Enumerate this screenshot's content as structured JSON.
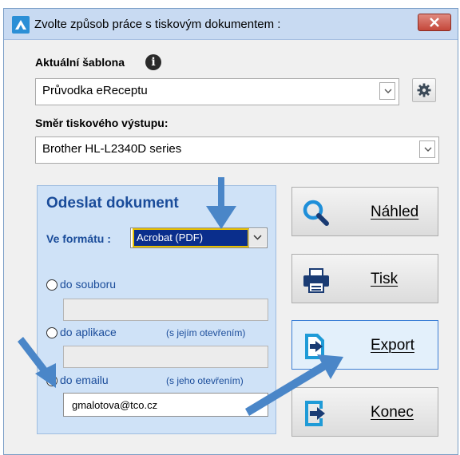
{
  "window": {
    "title": "Zvolte způsob práce s tiskovým dokumentem :"
  },
  "template": {
    "label": "Aktuální šablona",
    "value": "Průvodka eReceptu"
  },
  "output": {
    "label": "Směr tiskového výstupu:",
    "value": "Brother HL-L2340D series"
  },
  "send": {
    "title": "Odeslat dokument",
    "format_label": "Ve formátu :",
    "format_value": "Acrobat (PDF)",
    "options": [
      {
        "label": "do souboru",
        "hint": "",
        "checked": false
      },
      {
        "label": "do aplikace",
        "hint": "(s jejím otevřením)",
        "checked": false
      },
      {
        "label": "do emailu",
        "hint": "(s jeho otevřením)",
        "checked": true
      }
    ],
    "email": "gmalotova@tco.cz"
  },
  "buttons": {
    "preview": "Náhled",
    "print": "Tisk",
    "export": "Export",
    "close": "Konec"
  },
  "colors": {
    "panel_bg": "#cfe2f7",
    "panel_text": "#1a4c9a",
    "titlebar": "#c8daf2",
    "arrow": "#4a86c8"
  }
}
